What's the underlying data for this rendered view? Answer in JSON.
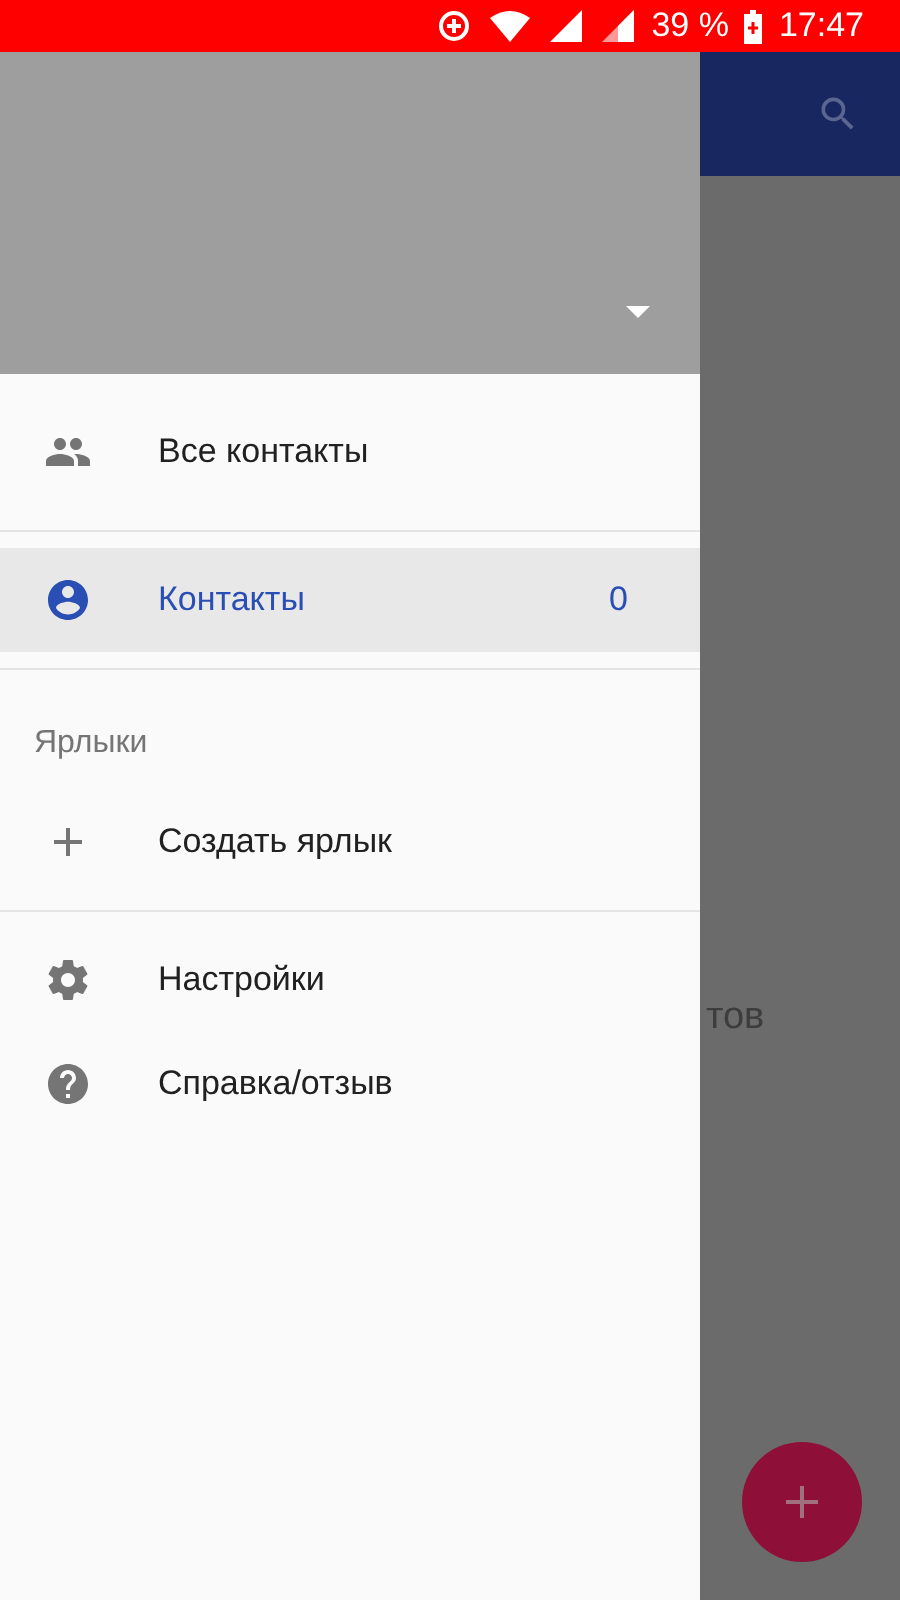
{
  "status_bar": {
    "battery": "39 %",
    "time": "17:47"
  },
  "background": {
    "partial_text": "тов"
  },
  "drawer": {
    "items": [
      {
        "kind": "item",
        "label": "Все контакты",
        "selected": false
      },
      {
        "kind": "divider"
      },
      {
        "kind": "item",
        "label": "Контакты",
        "count": "0",
        "selected": true
      },
      {
        "kind": "divider"
      },
      {
        "kind": "header",
        "label": "Ярлыки"
      },
      {
        "kind": "item",
        "label": "Создать ярлык",
        "selected": false
      },
      {
        "kind": "divider"
      },
      {
        "kind": "item",
        "label": "Настройки",
        "selected": false
      },
      {
        "kind": "item",
        "label": "Справка/отзыв",
        "selected": false
      }
    ]
  }
}
